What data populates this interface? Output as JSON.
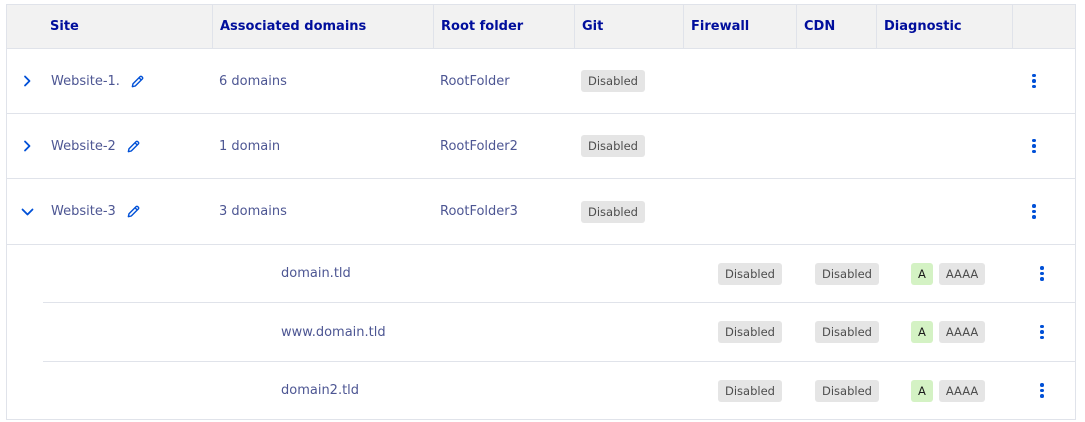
{
  "headers": {
    "site": "Site",
    "domains": "Associated domains",
    "root": "Root folder",
    "git": "Git",
    "firewall": "Firewall",
    "cdn": "CDN",
    "diagnostic": "Diagnostic"
  },
  "sites": [
    {
      "name": "Website-1.",
      "domains": "6 domains",
      "root": "RootFolder",
      "git": "Disabled",
      "expanded": false
    },
    {
      "name": "Website-2",
      "domains": "1 domain",
      "root": "RootFolder2",
      "git": "Disabled",
      "expanded": false
    },
    {
      "name": "Website-3",
      "domains": "3 domains",
      "root": "RootFolder3",
      "git": "Disabled",
      "expanded": true
    }
  ],
  "subdomains": [
    {
      "domain": "domain.tld",
      "firewall": "Disabled",
      "cdn": "Disabled",
      "diag_a": "A",
      "diag_aaaa": "AAAA"
    },
    {
      "domain": "www.domain.tld",
      "firewall": "Disabled",
      "cdn": "Disabled",
      "diag_a": "A",
      "diag_aaaa": "AAAA"
    },
    {
      "domain": "domain2.tld",
      "firewall": "Disabled",
      "cdn": "Disabled",
      "diag_a": "A",
      "diag_aaaa": "AAAA"
    }
  ],
  "icons": {
    "expand": "chevron-right-icon",
    "collapse": "chevron-down-icon",
    "edit": "pencil-icon",
    "actions": "more-vertical-icon"
  },
  "colors": {
    "header_text": "#000e9c",
    "body_text": "#4d5693",
    "accent": "#0050d7",
    "badge_grey": "#e5e5e5",
    "badge_green": "#d4f2c4"
  }
}
